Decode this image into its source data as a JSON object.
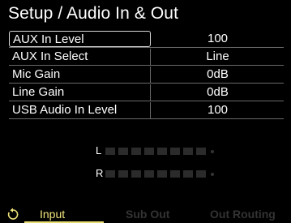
{
  "title": "Setup / Audio In & Out",
  "params": [
    {
      "label": "AUX In Level",
      "value": "100"
    },
    {
      "label": "AUX In Select",
      "value": "Line"
    },
    {
      "label": "Mic Gain",
      "value": "0dB"
    },
    {
      "label": "Line Gain",
      "value": "0dB"
    },
    {
      "label": "USB Audio In Level",
      "value": "100"
    }
  ],
  "meter": {
    "left_label": "L",
    "right_label": "R",
    "segments": 8,
    "left_level": 0,
    "right_level": 0
  },
  "tabs": [
    {
      "label": "Input"
    },
    {
      "label": "Sub Out"
    },
    {
      "label": "Out Routing"
    }
  ],
  "colors": {
    "accent": "#f0e37a",
    "inactive_tab": "#333333",
    "meter_off": "#2b2b2b"
  },
  "icons": {
    "back": "rotate-back-icon"
  }
}
